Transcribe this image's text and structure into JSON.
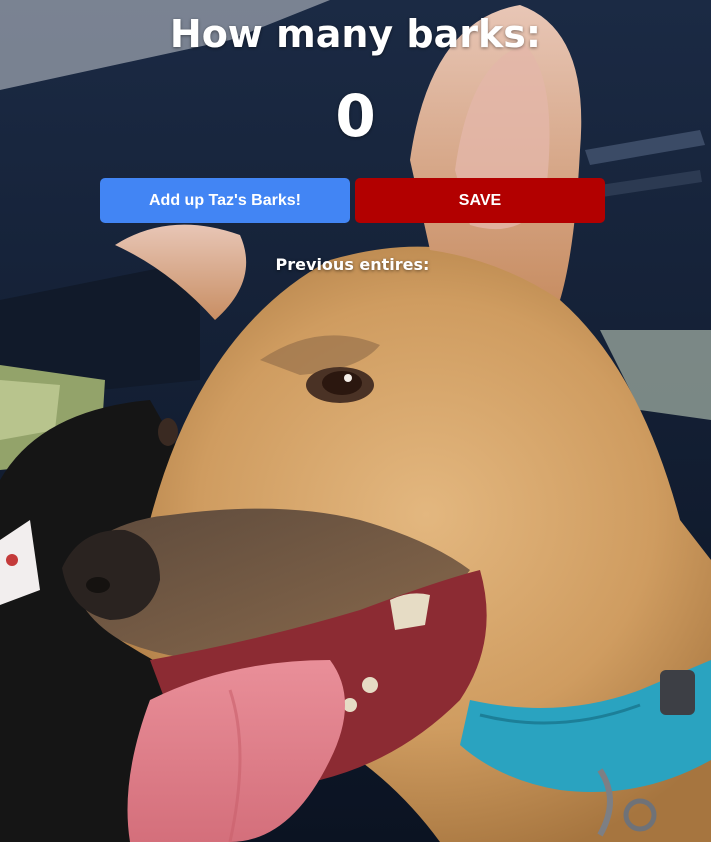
{
  "app": {
    "heading": "How many barks:",
    "count": "0"
  },
  "buttons": {
    "add_label": "Add up Taz's Barks!",
    "save_label": "SAVE"
  },
  "history": {
    "label": "Previous entires:",
    "entries": []
  },
  "background": {
    "subject": "dog-photo",
    "colors": {
      "interior": "#0c1526",
      "fur": "#d3a46b",
      "collar": "#2aa3c0",
      "tongue": "#e58a93"
    }
  },
  "colors": {
    "add_button": "#4285f4",
    "save_button": "#b20000",
    "text": "#ffffff"
  }
}
